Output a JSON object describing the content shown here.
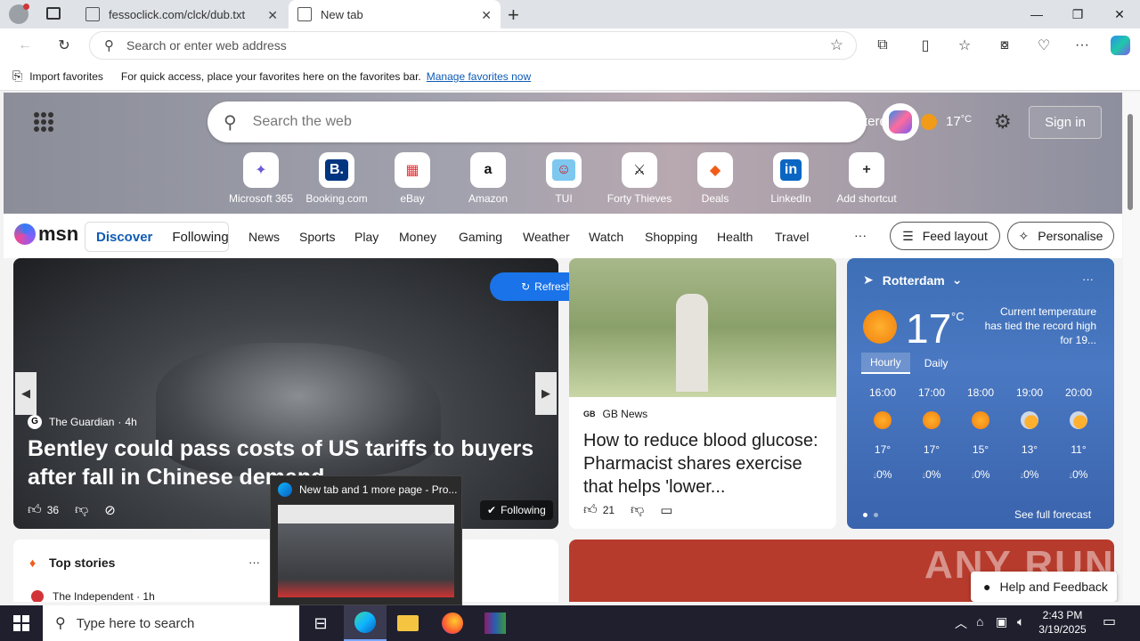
{
  "tabs": [
    {
      "title": "fessoclick.com/clck/dub.txt"
    },
    {
      "title": "New tab"
    }
  ],
  "address": {
    "placeholder": "Search or enter web address"
  },
  "favbar": {
    "import_label": "Import favorites",
    "message": "For quick access, place your favorites here on the favorites bar.",
    "manage_link": "Manage favorites now"
  },
  "hero": {
    "search_placeholder": "Search the web",
    "location_partial": "terdam",
    "temp": "17",
    "temp_unit": "°C",
    "sign_in": "Sign in"
  },
  "shortcuts": [
    {
      "label": "Microsoft 365",
      "glyph": "✦",
      "color": "#6b5bd6"
    },
    {
      "label": "Booking.com",
      "glyph": "B.",
      "color": "#fff",
      "bg": "#003580"
    },
    {
      "label": "eBay",
      "glyph": "▦",
      "color": "#e53238"
    },
    {
      "label": "Amazon",
      "glyph": "a",
      "color": "#111"
    },
    {
      "label": "TUI",
      "glyph": "☺",
      "color": "#d40e14",
      "bg": "#7ec8f0"
    },
    {
      "label": "Forty Thieves",
      "glyph": "⚔",
      "color": "#111"
    },
    {
      "label": "Deals",
      "glyph": "◆",
      "color": "#f25c19"
    },
    {
      "label": "LinkedIn",
      "glyph": "in",
      "color": "#fff",
      "bg": "#0a66c2"
    },
    {
      "label": "Add shortcut",
      "glyph": "+",
      "color": "#333"
    }
  ],
  "msn": {
    "logo": "msn",
    "tabs": [
      "Discover",
      "Following"
    ],
    "nav": [
      "News",
      "Sports",
      "Play",
      "Money",
      "Gaming",
      "Weather",
      "Watch",
      "Shopping",
      "Health",
      "Travel"
    ],
    "more": "···",
    "feed_layout": "Feed layout",
    "personalise": "Personalise"
  },
  "refresh": "Refresh stories",
  "bentley": {
    "source": "The Guardian",
    "age": "4h",
    "headline": "Bentley could pass costs of US tariffs to buyers after fall in Chinese demand",
    "likes": "36",
    "following": "Following"
  },
  "gbnews": {
    "source": "GB News",
    "headline": "How to reduce blood glucose: Pharmacist shares exercise that helps 'lower...",
    "likes": "21"
  },
  "weather": {
    "city": "Rotterdam",
    "temp": "17",
    "unit": "°C",
    "note": "Current temperature has tied the record high for 19...",
    "tabs": [
      "Hourly",
      "Daily"
    ],
    "hours": [
      {
        "time": "16:00",
        "t": "17°",
        "p": "0%",
        "icon": "sun"
      },
      {
        "time": "17:00",
        "t": "17°",
        "p": "0%",
        "icon": "sun"
      },
      {
        "time": "18:00",
        "t": "15°",
        "p": "0%",
        "icon": "sun"
      },
      {
        "time": "19:00",
        "t": "13°",
        "p": "0%",
        "icon": "partly"
      },
      {
        "time": "20:00",
        "t": "11°",
        "p": "0%",
        "icon": "partly"
      }
    ],
    "see_full": "See full forecast"
  },
  "topstories": {
    "title": "Top stories",
    "more": "···",
    "item_source": "The Independent · 1h"
  },
  "help": "Help and Feedback",
  "watermark": "ANY RUN",
  "preview": {
    "title": "New tab and 1 more page - Pro..."
  },
  "taskbar": {
    "search_placeholder": "Type here to search",
    "time": "2:43 PM",
    "date": "3/19/2025"
  }
}
